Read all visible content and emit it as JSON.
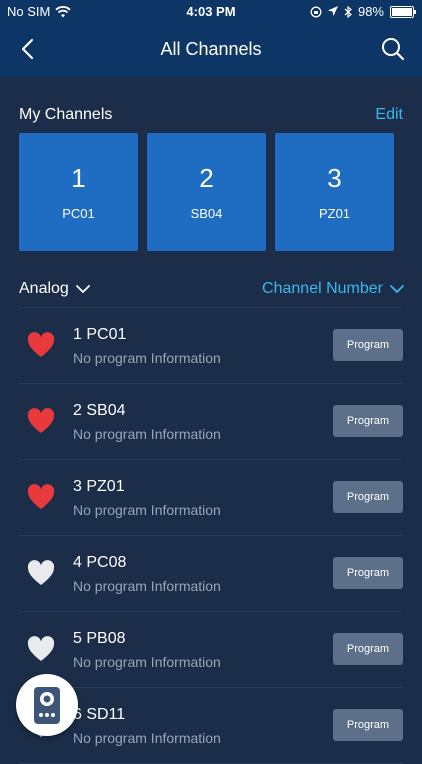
{
  "status_bar": {
    "carrier": "No SIM",
    "time": "4:03 PM",
    "battery": "98%",
    "battery_level": 0.98
  },
  "nav": {
    "title": "All Channels"
  },
  "my_channels": {
    "title": "My Channels",
    "edit_label": "Edit",
    "cards": [
      {
        "number": "1",
        "name": "PC01"
      },
      {
        "number": "2",
        "name": "SB04"
      },
      {
        "number": "3",
        "name": "PZ01"
      }
    ]
  },
  "filters": {
    "left_label": "Analog",
    "right_label": "Channel Number"
  },
  "channels": [
    {
      "title": "1 PC01",
      "subtitle": "No program Information",
      "button": "Program",
      "favorite": true
    },
    {
      "title": "2 SB04",
      "subtitle": "No program Information",
      "button": "Program",
      "favorite": true
    },
    {
      "title": "3 PZ01",
      "subtitle": "No program Information",
      "button": "Program",
      "favorite": true
    },
    {
      "title": "4 PC08",
      "subtitle": "No program Information",
      "button": "Program",
      "favorite": false
    },
    {
      "title": "5 PB08",
      "subtitle": "No program Information",
      "button": "Program",
      "favorite": false
    },
    {
      "title": "6 SD11",
      "subtitle": "No program Information",
      "button": "Program",
      "favorite": false
    }
  ],
  "colors": {
    "favorite": "#e83a3c",
    "not_favorite": "#e8eaee",
    "accent": "#3ab8ee",
    "card": "#1f6cc3"
  },
  "icons": {
    "back": "chevron-left-icon",
    "search": "search-icon",
    "heart": "heart-icon",
    "remote": "remote-control-icon"
  }
}
